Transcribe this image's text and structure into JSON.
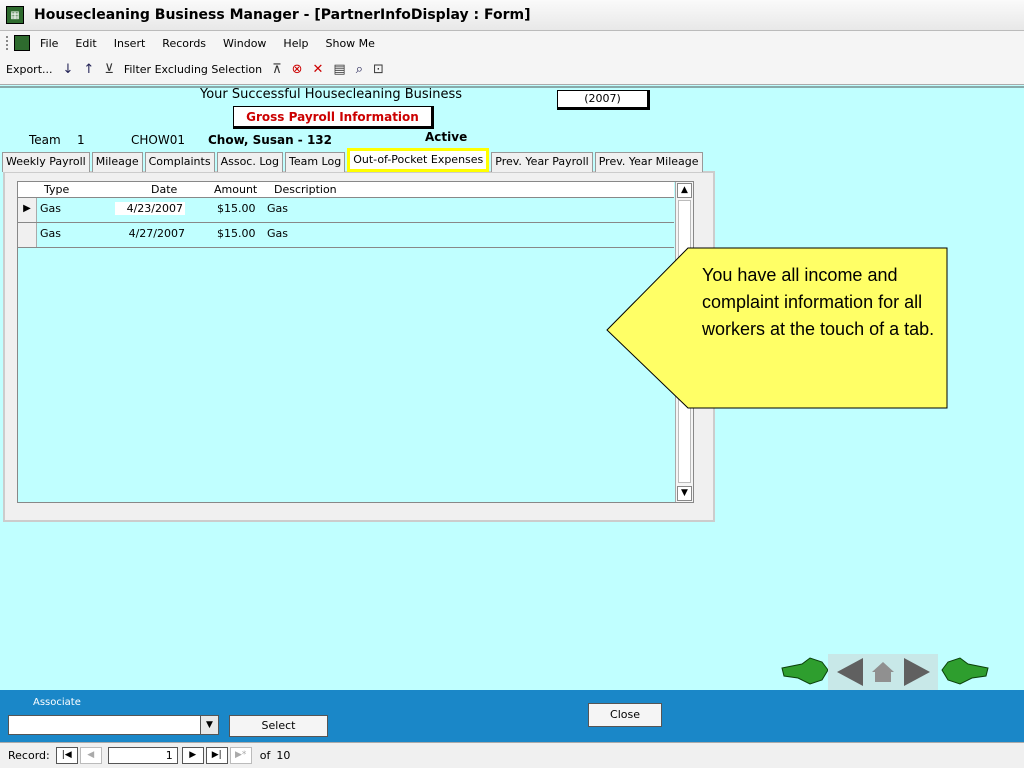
{
  "window": {
    "title": "Housecleaning Business Manager - [PartnerInfoDisplay : Form]",
    "icon": "access-app-icon"
  },
  "menu": {
    "items": [
      "File",
      "Edit",
      "Insert",
      "Records",
      "Window",
      "Help",
      "Show Me"
    ]
  },
  "toolbar": {
    "export_label": "Export...",
    "filter_label": "Filter Excluding Selection"
  },
  "form": {
    "company": "Your Successful Housecleaning Business",
    "year": "(2007)",
    "title": "Gross Payroll Information",
    "team_label": "Team",
    "team_number": "1",
    "code": "CHOW01",
    "name": "Chow, Susan - 132",
    "status": "Active"
  },
  "tabs": [
    {
      "label": "Weekly Payroll"
    },
    {
      "label": "Mileage"
    },
    {
      "label": "Complaints"
    },
    {
      "label": "Assoc. Log"
    },
    {
      "label": "Team Log"
    },
    {
      "label": "Out-of-Pocket Expenses"
    },
    {
      "label": "Prev. Year Payroll"
    },
    {
      "label": "Prev. Year Mileage"
    }
  ],
  "active_tab": "Out-of-Pocket Expenses",
  "table": {
    "headers": {
      "type": "Type",
      "date": "Date",
      "amount": "Amount",
      "description": "Description"
    },
    "rows": [
      {
        "type": "Gas",
        "date": "4/23/2007",
        "amount": "$15.00",
        "description": "Gas"
      },
      {
        "type": "Gas",
        "date": "4/27/2007",
        "amount": "$15.00",
        "description": "Gas"
      }
    ]
  },
  "callout": {
    "text": "You have all income and complaint information for all workers at the touch of a tab."
  },
  "bottom": {
    "associate_label": "Associate",
    "select_label": "Select",
    "close_label": "Close"
  },
  "record_nav": {
    "label": "Record:",
    "current": "1",
    "of_label": "of",
    "total": "10"
  },
  "colors": {
    "form_bg": "#c0ffff",
    "bottom_bar": "#1a87c8",
    "tab_highlight": "#ffff00",
    "title_red": "#cc0000",
    "callout_fill": "#ffff66"
  }
}
